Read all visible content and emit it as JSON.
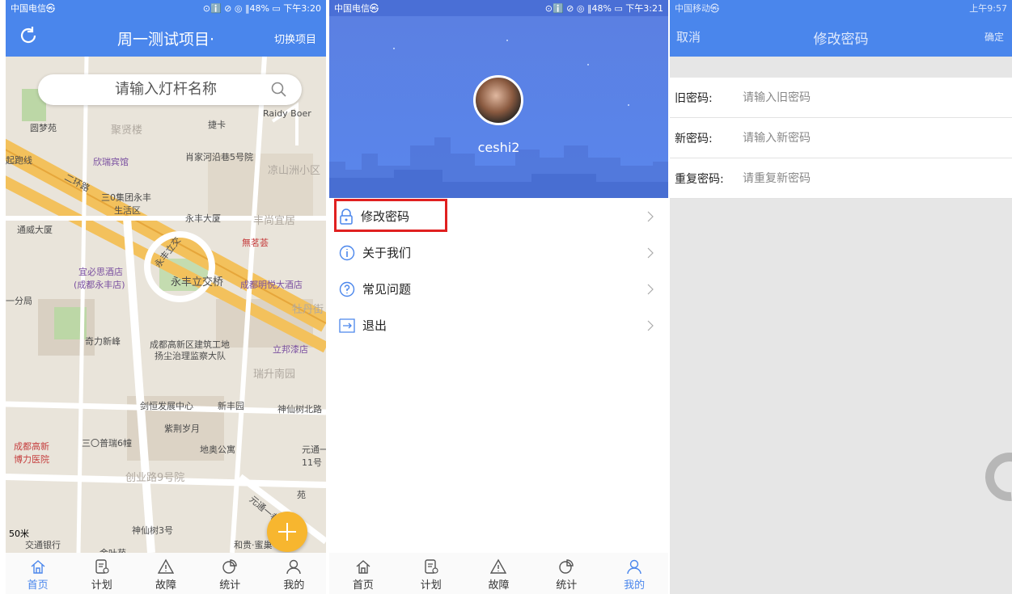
{
  "panel1": {
    "status_left": "中国电信㉿",
    "status_right": "⊙ℹ️ ⊘ ◎ ‖48% ▭ 下午3:20",
    "title": "周一测试项目·",
    "switch_label": "切换项目",
    "search_placeholder": "请输入灯杆名称",
    "map_labels": {
      "l1": "圆梦苑",
      "l2": "聚贤楼",
      "l3": "捷卡",
      "l4": "Raidy Boer",
      "l5": "欣瑞宾馆",
      "l6": "肖家河沿巷5号院",
      "l7": "凉山洲小区",
      "l8": "三0集团永丰",
      "l9": "生活区",
      "l10": "永丰大厦",
      "l11": "丰尚宜居",
      "l12": "通威大厦",
      "l13": "無茗荟",
      "l14": "宜必思酒店",
      "l15": "(成都永丰店)",
      "l16": "永丰立交桥",
      "l17": "成都明悦大酒店",
      "l18": "牡丹街",
      "l19": "一分局",
      "l20": "奇力新峰",
      "l21": "成都高新区建筑工地",
      "l22": "扬尘治理监察大队",
      "l23": "立邦漆店",
      "l24": "瑞升南园",
      "l25": "剑恒发展中心",
      "l26": "新丰园",
      "l27": "神仙树北路",
      "l28": "紫荆岁月",
      "l29": "成都高新",
      "l30": "博力医院",
      "l31": "三〇普瑞6幢",
      "l32": "地奥公寓",
      "l33": "元通一",
      "l34": "11号",
      "l35": "创业路9号院",
      "l36": "神仙树3号",
      "l37": "交通银行",
      "l38": "和贵·蜜巢",
      "l39": "金叶苑",
      "l40": "二环路",
      "l41": "永丰立交",
      "l42": "元通一巷",
      "l43": "苑",
      "l44": "起跑线",
      "scale": "50米"
    },
    "tabs": [
      "首页",
      "计划",
      "故障",
      "统计",
      "我的"
    ]
  },
  "panel2": {
    "status_left": "中国电信㉿",
    "status_right": "⊙ℹ️ ⊘ ◎ ‖48% ▭ 下午3:21",
    "username": "ceshi2",
    "menu": [
      "修改密码",
      "关于我们",
      "常见问题",
      "退出"
    ],
    "tabs": [
      "首页",
      "计划",
      "故障",
      "统计",
      "我的"
    ]
  },
  "panel3": {
    "status_left": "中国移动㉿",
    "status_right": "上午9:57",
    "cancel": "取消",
    "title": "修改密码",
    "confirm": "确定",
    "fields": [
      {
        "label": "旧密码:",
        "placeholder": "请输入旧密码"
      },
      {
        "label": "新密码:",
        "placeholder": "请输入新密码"
      },
      {
        "label": "重复密码:",
        "placeholder": "请重复新密码"
      }
    ]
  },
  "colors": {
    "primary": "#4a86ec",
    "fab": "#f7b62f",
    "highlight": "#e02020"
  }
}
